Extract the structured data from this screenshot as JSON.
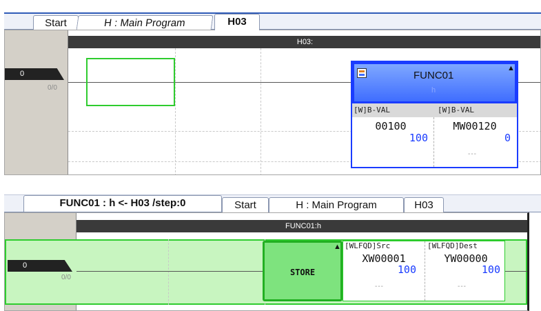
{
  "top": {
    "tabs": [
      {
        "label": "Start"
      },
      {
        "label": "H : Main Program"
      },
      {
        "label": "H03"
      }
    ],
    "header": "H03:",
    "row": {
      "number": "0",
      "sub": "0/0"
    },
    "func_block": {
      "name": "FUNC01",
      "sub": "h",
      "in_type": "[W]B-VAL",
      "out_type": "[W]B-VAL",
      "in_addr": "00100",
      "out_addr": "MW00120",
      "in_val": "100",
      "out_val": "0",
      "out_dash": "---"
    }
  },
  "bottom": {
    "tabs": [
      {
        "label": "FUNC01 : h <- H03 /step:0"
      },
      {
        "label": "Start"
      },
      {
        "label": "H : Main Program"
      },
      {
        "label": "H03"
      }
    ],
    "header": "FUNC01:h",
    "row": {
      "number": "0",
      "sub": "0/0"
    },
    "store_block": {
      "label": "STORE",
      "src_type": "[WLFQD]Src",
      "dest_type": "[WLFQD]Dest",
      "src_addr": "XW00001",
      "dest_addr": "YW00000",
      "src_val": "100",
      "dest_val": "100",
      "src_dash": "---",
      "dest_dash": "---"
    }
  },
  "colors": {
    "accent_blue": "#1a3cff",
    "active_green": "#2ecc2e",
    "highlight_green": "#c8f5c0"
  }
}
